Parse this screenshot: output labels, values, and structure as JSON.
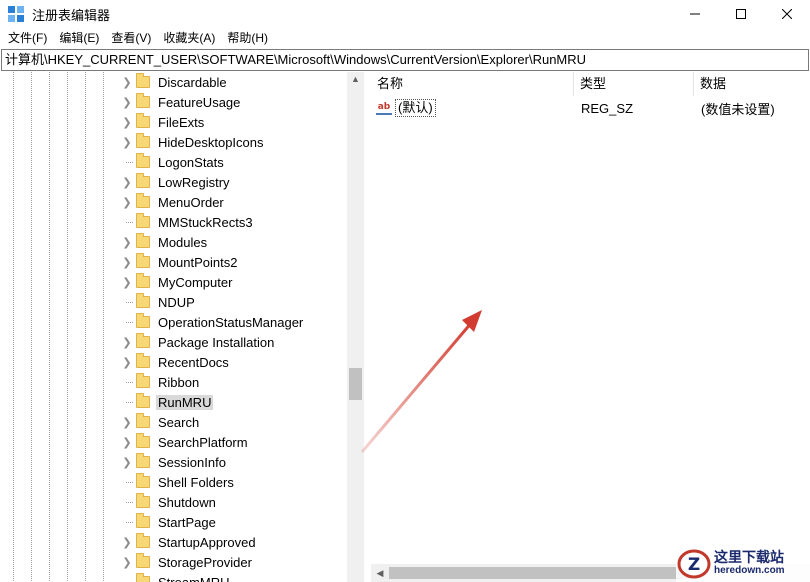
{
  "window": {
    "title": "注册表编辑器",
    "controls": {
      "minimize": "minimize-icon",
      "maximize": "maximize-icon",
      "close": "close-icon"
    }
  },
  "menu": {
    "items": [
      "文件(F)",
      "编辑(E)",
      "查看(V)",
      "收藏夹(A)",
      "帮助(H)"
    ]
  },
  "address": {
    "path": "计算机\\HKEY_CURRENT_USER\\SOFTWARE\\Microsoft\\Windows\\CurrentVersion\\Explorer\\RunMRU"
  },
  "tree": {
    "items": [
      {
        "label": "Discardable",
        "expandable": true
      },
      {
        "label": "FeatureUsage",
        "expandable": true
      },
      {
        "label": "FileExts",
        "expandable": true
      },
      {
        "label": "HideDesktopIcons",
        "expandable": true
      },
      {
        "label": "LogonStats",
        "expandable": false
      },
      {
        "label": "LowRegistry",
        "expandable": true
      },
      {
        "label": "MenuOrder",
        "expandable": true
      },
      {
        "label": "MMStuckRects3",
        "expandable": false
      },
      {
        "label": "Modules",
        "expandable": true
      },
      {
        "label": "MountPoints2",
        "expandable": true
      },
      {
        "label": "MyComputer",
        "expandable": true
      },
      {
        "label": "NDUP",
        "expandable": false
      },
      {
        "label": "OperationStatusManager",
        "expandable": false
      },
      {
        "label": "Package Installation",
        "expandable": true
      },
      {
        "label": "RecentDocs",
        "expandable": true
      },
      {
        "label": "Ribbon",
        "expandable": false
      },
      {
        "label": "RunMRU",
        "expandable": false,
        "selected": true
      },
      {
        "label": "Search",
        "expandable": true
      },
      {
        "label": "SearchPlatform",
        "expandable": true
      },
      {
        "label": "SessionInfo",
        "expandable": true
      },
      {
        "label": "Shell Folders",
        "expandable": false
      },
      {
        "label": "Shutdown",
        "expandable": false
      },
      {
        "label": "StartPage",
        "expandable": false
      },
      {
        "label": "StartupApproved",
        "expandable": true
      },
      {
        "label": "StorageProvider",
        "expandable": true
      },
      {
        "label": "StreamMRU",
        "expandable": false
      }
    ]
  },
  "list": {
    "columns": {
      "name": "名称",
      "type": "类型",
      "data": "数据"
    },
    "rows": [
      {
        "icon": "string-value-icon",
        "icon_text": "ab",
        "name": "(默认)",
        "type": "REG_SZ",
        "data": "(数值未设置)"
      }
    ]
  },
  "watermark": {
    "cn": "这里下载站",
    "en": "heredown.com",
    "logo_letter": "Z"
  },
  "colors": {
    "folder": "#f8d775",
    "selection": "#d9d9d9",
    "arrow": "#d23b2f",
    "watermark": "#1a2a6c"
  }
}
